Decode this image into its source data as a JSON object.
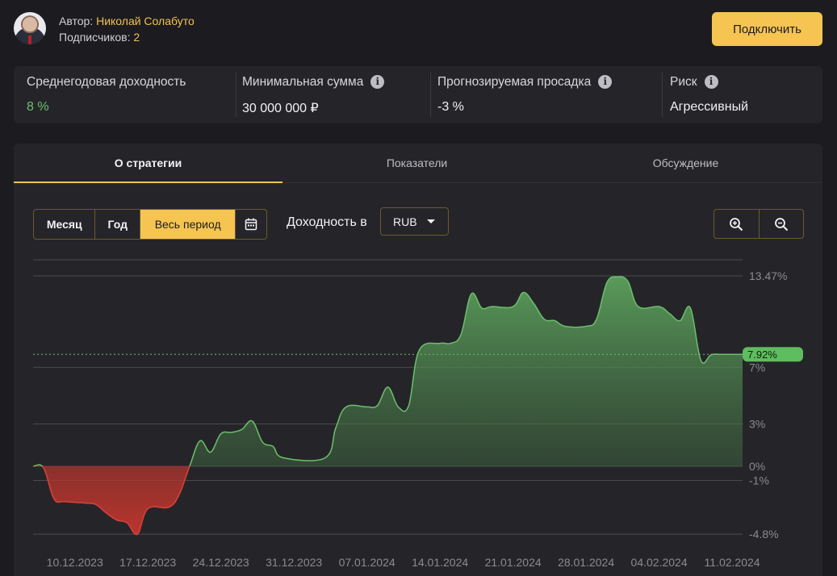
{
  "author": {
    "prefix": "Автор: ",
    "name": "Николай Солабуто",
    "subscribers_prefix": "Подписчиков: ",
    "subscribers": "2"
  },
  "header": {
    "connect_label": "Подключить"
  },
  "stats": [
    {
      "label": "Среднегодовая доходность",
      "value": "8 %",
      "has_info": false
    },
    {
      "label": "Минимальная сумма",
      "value": "30 000 000 ₽",
      "has_info": true
    },
    {
      "label": "Прогнозируемая просадка",
      "value": "-3 %",
      "has_info": true
    },
    {
      "label": "Риск",
      "value": "Агрессивный",
      "has_info": true
    }
  ],
  "tabs": [
    {
      "label": "О стратегии",
      "active": true
    },
    {
      "label": "Показатели",
      "active": false
    },
    {
      "label": "Обсуждение",
      "active": false
    }
  ],
  "period": {
    "options": [
      "Месяц",
      "Год",
      "Весь период"
    ],
    "selected": "Весь период",
    "calendar_icon": "calendar-icon"
  },
  "yield": {
    "label": "Доходность в",
    "currency": "RUB"
  },
  "zoom": {
    "in_icon": "zoom-in-icon",
    "out_icon": "zoom-out-icon"
  },
  "colors": {
    "accent": "#f5c451",
    "positive": "#6cc06c",
    "negative": "#d9423a",
    "background": "#1c1c20",
    "panel": "#252529"
  },
  "chart_data": {
    "type": "area",
    "y_ticks": [
      "13.47%",
      "7%",
      "3%",
      "0%",
      "-1%",
      "-4.8%"
    ],
    "y_tick_values": [
      13.47,
      7,
      3,
      0,
      -1,
      -4.8
    ],
    "x_ticks": [
      "10.12.2023",
      "17.12.2023",
      "24.12.2023",
      "31.12.2023",
      "07.01.2024",
      "14.01.2024",
      "21.01.2024",
      "28.01.2024",
      "04.02.2024",
      "11.02.2024"
    ],
    "x_tick_dates": [
      "2023-12-10",
      "2023-12-17",
      "2023-12-24",
      "2023-12-31",
      "2024-01-07",
      "2024-01-14",
      "2024-01-21",
      "2024-01-28",
      "2024-02-04",
      "2024-02-11"
    ],
    "current_value_label": "7.92%",
    "current_value": 7.92,
    "series": [
      {
        "points": [
          [
            "2023-12-06",
            0.0
          ],
          [
            "2023-12-07",
            -0.1
          ],
          [
            "2023-12-08",
            -2.3
          ],
          [
            "2023-12-09",
            -2.5
          ],
          [
            "2023-12-11",
            -2.6
          ],
          [
            "2023-12-12",
            -2.7
          ],
          [
            "2023-12-13",
            -3.3
          ],
          [
            "2023-12-14",
            -3.8
          ],
          [
            "2023-12-15",
            -4.0
          ],
          [
            "2023-12-16",
            -4.8
          ],
          [
            "2023-12-17",
            -3.0
          ],
          [
            "2023-12-19",
            -2.9
          ],
          [
            "2023-12-20",
            -2.0
          ],
          [
            "2023-12-21",
            0.0
          ],
          [
            "2023-12-22",
            1.8
          ],
          [
            "2023-12-23",
            1.0
          ],
          [
            "2023-12-24",
            2.3
          ],
          [
            "2023-12-25",
            2.4
          ],
          [
            "2023-12-26",
            2.6
          ],
          [
            "2023-12-27",
            3.2
          ],
          [
            "2023-12-28",
            1.7
          ],
          [
            "2023-12-29",
            1.4
          ],
          [
            "2023-12-30",
            0.6
          ],
          [
            "2024-01-03",
            0.6
          ],
          [
            "2024-01-04",
            2.7
          ],
          [
            "2024-01-05",
            4.2
          ],
          [
            "2024-01-07",
            4.2
          ],
          [
            "2024-01-08",
            4.3
          ],
          [
            "2024-01-09",
            5.6
          ],
          [
            "2024-01-10",
            4.2
          ],
          [
            "2024-01-11",
            4.3
          ],
          [
            "2024-01-12",
            8.2
          ],
          [
            "2024-01-14",
            8.7
          ],
          [
            "2024-01-15",
            8.7
          ],
          [
            "2024-01-16",
            9.3
          ],
          [
            "2024-01-17",
            12.2
          ],
          [
            "2024-01-18",
            11.2
          ],
          [
            "2024-01-19",
            11.3
          ],
          [
            "2024-01-21",
            11.3
          ],
          [
            "2024-01-22",
            12.3
          ],
          [
            "2024-01-23",
            11.5
          ],
          [
            "2024-01-24",
            10.4
          ],
          [
            "2024-01-25",
            10.3
          ],
          [
            "2024-01-26",
            9.9
          ],
          [
            "2024-01-28",
            9.9
          ],
          [
            "2024-01-29",
            10.4
          ],
          [
            "2024-01-30",
            13.0
          ],
          [
            "2024-01-31",
            13.4
          ],
          [
            "2024-02-01",
            13.1
          ],
          [
            "2024-02-02",
            11.3
          ],
          [
            "2024-02-04",
            11.3
          ],
          [
            "2024-02-05",
            10.8
          ],
          [
            "2024-02-06",
            10.3
          ],
          [
            "2024-02-07",
            11.2
          ],
          [
            "2024-02-08",
            7.5
          ],
          [
            "2024-02-09",
            7.9
          ],
          [
            "2024-02-10",
            7.92
          ],
          [
            "2024-02-12",
            7.92
          ]
        ]
      }
    ]
  }
}
